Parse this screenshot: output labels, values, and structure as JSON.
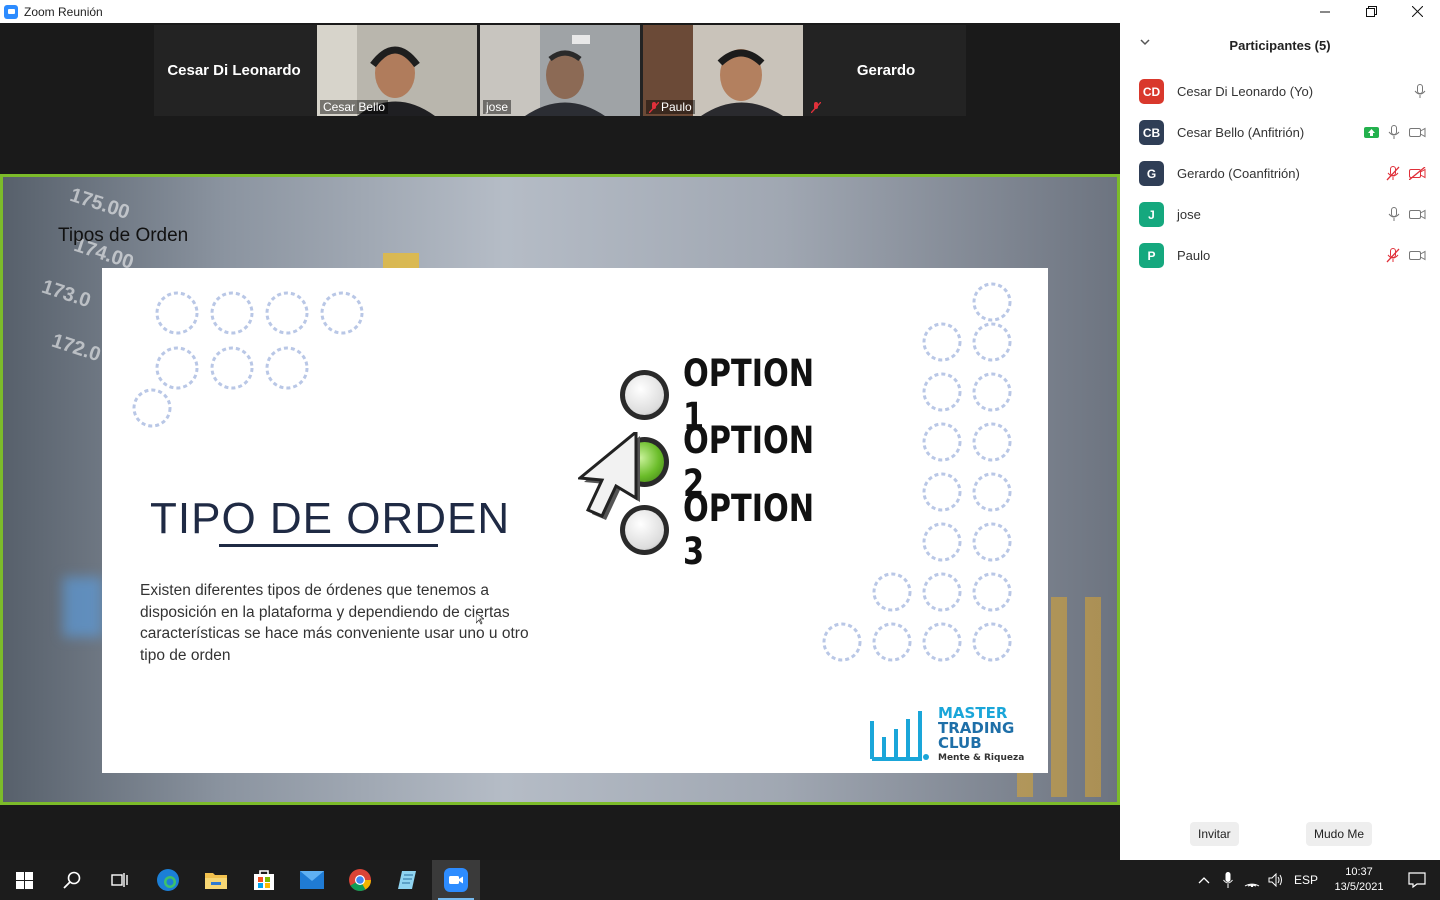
{
  "window": {
    "title": "Zoom Reunión",
    "controls": [
      "minimize",
      "restore",
      "close"
    ]
  },
  "video_strip": {
    "tiles": [
      {
        "name": "Cesar Di Leonardo",
        "video": false
      },
      {
        "name": "Cesar Bello",
        "video": true,
        "active_speaker": true
      },
      {
        "name": "jose",
        "video": true
      },
      {
        "name": "Paulo",
        "video": true,
        "muted": true
      },
      {
        "name": "Gerardo",
        "video": false,
        "muted": true
      }
    ]
  },
  "shared_screen": {
    "heading": "Tipos de Orden",
    "slide": {
      "title": "TIPO DE ORDEN",
      "description": "Existen diferentes tipos de órdenes que tenemos a disposición en la plataforma y dependiendo de ciertas características se hace más conveniente usar uno u otro tipo de orden",
      "options": [
        {
          "label": "OPTION 1",
          "selected": false
        },
        {
          "label": "OPTION 2",
          "selected": true
        },
        {
          "label": "OPTION 3",
          "selected": false
        }
      ],
      "logo": {
        "line1": "MASTER",
        "line2": "TRADING",
        "line3": "CLUB",
        "tagline": "Mente & Riqueza"
      }
    },
    "background_numbers": [
      "175.00",
      "174.00",
      "173.0",
      "172.0"
    ]
  },
  "participants_panel": {
    "title": "Participantes (5)",
    "participants": [
      {
        "initials": "CD",
        "name": "Cesar Di Leonardo (Yo)",
        "color": "#d9382c",
        "mic": "on",
        "video": "none",
        "share_badge": false
      },
      {
        "initials": "CB",
        "name": "Cesar Bello (Anfitrión)",
        "color": "#2f3e56",
        "mic": "on",
        "video": "on",
        "share_badge": true
      },
      {
        "initials": "G",
        "name": "Gerardo (Coanfitrión)",
        "color": "#2f3e56",
        "mic": "muted",
        "video": "off",
        "share_badge": false
      },
      {
        "initials": "J",
        "name": "jose",
        "color": "#15a87e",
        "mic": "on",
        "video": "on",
        "share_badge": false
      },
      {
        "initials": "P",
        "name": "Paulo",
        "color": "#15a87e",
        "mic": "muted",
        "video": "on",
        "share_badge": false
      }
    ],
    "footer": {
      "invite_label": "Invitar",
      "mute_me_label": "Mudo Me"
    }
  },
  "taskbar": {
    "apps": [
      "start-icon",
      "search-icon",
      "task-view-icon",
      "edge-icon",
      "file-explorer-icon",
      "store-icon",
      "mail-icon",
      "chrome-icon",
      "notepad-icon",
      "zoom-icon"
    ],
    "tray": {
      "language": "ESP",
      "time": "10:37",
      "date": "13/5/2021"
    }
  }
}
